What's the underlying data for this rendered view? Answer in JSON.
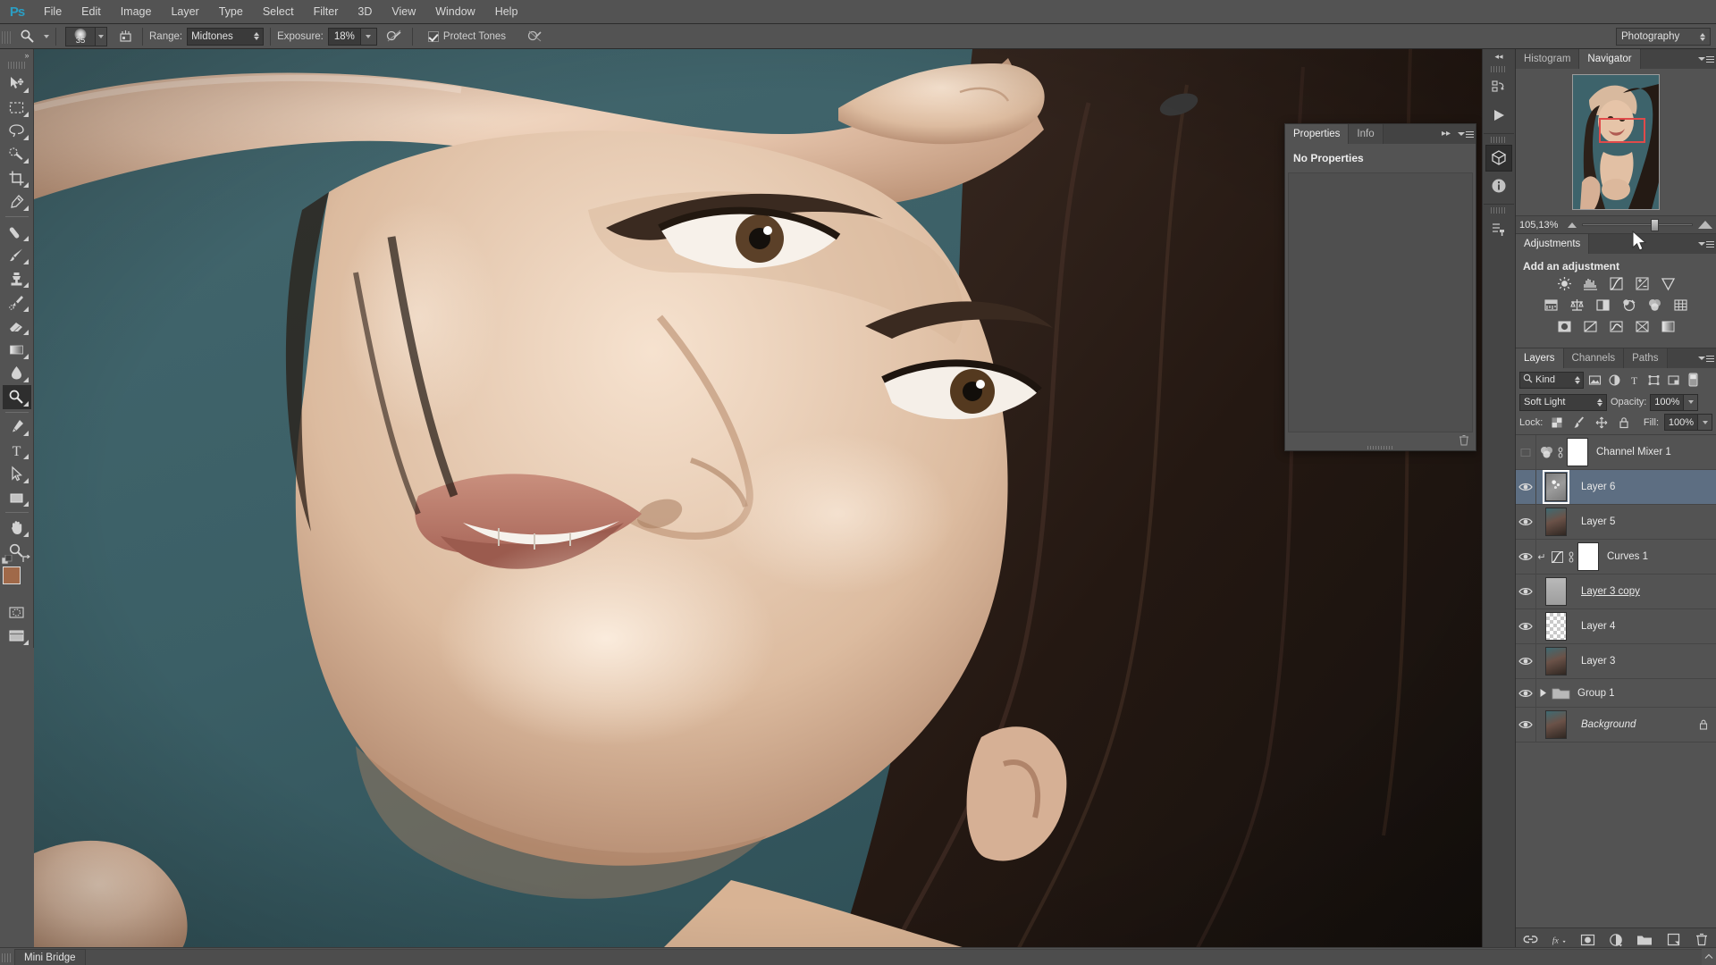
{
  "app": {
    "name": "Adobe Photoshop",
    "logo_text": "Ps"
  },
  "menubar": {
    "items": [
      {
        "label": "File"
      },
      {
        "label": "Edit"
      },
      {
        "label": "Image"
      },
      {
        "label": "Layer"
      },
      {
        "label": "Type"
      },
      {
        "label": "Select"
      },
      {
        "label": "Filter"
      },
      {
        "label": "3D"
      },
      {
        "label": "View"
      },
      {
        "label": "Window"
      },
      {
        "label": "Help"
      }
    ]
  },
  "options_bar": {
    "tool_icon": "dodge-tool-icon",
    "brush_size": "35",
    "range_label": "Range:",
    "range_value": "Midtones",
    "exposure_label": "Exposure:",
    "exposure_value": "18%",
    "airbrush_icon": "airbrush-icon",
    "protect_tones_label": "Protect Tones",
    "protect_tones_checked": true,
    "pressure_icon": "tablet-pressure-icon",
    "workspace": "Photography"
  },
  "toolbar": {
    "collapse_icon": "double-chevron-right-icon",
    "tools": [
      {
        "name": "move-tool",
        "icon": "move-icon",
        "selected": false,
        "has_flyout": true
      },
      {
        "name": "marquee-tool",
        "icon": "rectangular-marquee-icon",
        "selected": false,
        "has_flyout": true
      },
      {
        "name": "lasso-tool",
        "icon": "lasso-icon",
        "selected": false,
        "has_flyout": true
      },
      {
        "name": "quick-selection-tool",
        "icon": "quick-selection-icon",
        "selected": false,
        "has_flyout": true
      },
      {
        "name": "crop-tool",
        "icon": "crop-icon",
        "selected": false,
        "has_flyout": true
      },
      {
        "name": "eyedropper-tool",
        "icon": "eyedropper-icon",
        "selected": false,
        "has_flyout": true
      },
      {
        "name": "healing-brush-tool",
        "icon": "healing-brush-icon",
        "selected": false,
        "has_flyout": true
      },
      {
        "name": "brush-tool",
        "icon": "brush-icon",
        "selected": false,
        "has_flyout": true
      },
      {
        "name": "clone-stamp-tool",
        "icon": "clone-stamp-icon",
        "selected": false,
        "has_flyout": true
      },
      {
        "name": "history-brush-tool",
        "icon": "history-brush-icon",
        "selected": false,
        "has_flyout": true
      },
      {
        "name": "eraser-tool",
        "icon": "eraser-icon",
        "selected": false,
        "has_flyout": true
      },
      {
        "name": "gradient-tool",
        "icon": "gradient-icon",
        "selected": false,
        "has_flyout": true
      },
      {
        "name": "blur-tool",
        "icon": "blur-droplet-icon",
        "selected": false,
        "has_flyout": true
      },
      {
        "name": "dodge-tool",
        "icon": "dodge-icon",
        "selected": true,
        "has_flyout": true
      },
      {
        "name": "pen-tool",
        "icon": "pen-icon",
        "selected": false,
        "has_flyout": true
      },
      {
        "name": "type-tool",
        "icon": "type-t-icon",
        "selected": false,
        "has_flyout": true
      },
      {
        "name": "path-selection-tool",
        "icon": "path-arrow-icon",
        "selected": false,
        "has_flyout": true
      },
      {
        "name": "shape-tool",
        "icon": "rectangle-shape-icon",
        "selected": false,
        "has_flyout": true
      },
      {
        "name": "hand-tool",
        "icon": "hand-icon",
        "selected": false,
        "has_flyout": true
      },
      {
        "name": "zoom-tool",
        "icon": "magnifier-icon",
        "selected": false,
        "has_flyout": false
      }
    ],
    "foreground_color": "#a06949",
    "background_color": "#b78a72",
    "quick_mask_icon": "quick-mask-icon",
    "screen_mode_icon": "screen-mode-icon"
  },
  "dock_rail": {
    "collapse_icon": "double-chevron-left-icon",
    "buttons": [
      {
        "name": "history-panel-icon",
        "active": false
      },
      {
        "name": "actions-play-icon",
        "active": false
      },
      {
        "name": "mini-bridge-icon",
        "active": true
      },
      {
        "name": "info-panel-icon",
        "active": false
      },
      {
        "name": "tool-presets-icon",
        "active": false
      }
    ]
  },
  "navigator_panel": {
    "tabs": [
      {
        "label": "Histogram",
        "active": false
      },
      {
        "label": "Navigator",
        "active": true
      }
    ],
    "zoom_level": "105,13%",
    "viewbox_color": "#e04a4a"
  },
  "adjustments_panel": {
    "tab_label": "Adjustments",
    "heading": "Add an adjustment",
    "rows": [
      [
        {
          "name": "brightness-contrast-icon"
        },
        {
          "name": "levels-icon"
        },
        {
          "name": "curves-icon"
        },
        {
          "name": "exposure-icon"
        },
        {
          "name": "vibrance-icon"
        }
      ],
      [
        {
          "name": "hue-saturation-icon"
        },
        {
          "name": "color-balance-icon"
        },
        {
          "name": "black-white-icon"
        },
        {
          "name": "photo-filter-icon"
        },
        {
          "name": "channel-mixer-icon"
        },
        {
          "name": "color-lookup-icon"
        }
      ],
      [
        {
          "name": "invert-icon"
        },
        {
          "name": "posterize-icon"
        },
        {
          "name": "threshold-icon"
        },
        {
          "name": "selective-color-icon"
        },
        {
          "name": "gradient-map-icon"
        }
      ]
    ]
  },
  "layers_panel": {
    "tabs": [
      {
        "label": "Layers",
        "active": true
      },
      {
        "label": "Channels",
        "active": false
      },
      {
        "label": "Paths",
        "active": false
      }
    ],
    "filter": {
      "search_icon": "search-icon",
      "kind_label": "Kind",
      "buttons": [
        {
          "name": "filter-pixel-icon"
        },
        {
          "name": "filter-adjustment-icon"
        },
        {
          "name": "filter-type-icon"
        },
        {
          "name": "filter-shape-icon"
        },
        {
          "name": "filter-smart-object-icon"
        }
      ],
      "toggle_icon": "filter-toggle-icon"
    },
    "blend_mode": "Soft Light",
    "opacity_label": "Opacity:",
    "opacity_value": "100%",
    "lock_label": "Lock:",
    "lock_buttons": [
      {
        "name": "lock-transparency-icon"
      },
      {
        "name": "lock-image-icon"
      },
      {
        "name": "lock-position-icon"
      },
      {
        "name": "lock-all-icon"
      }
    ],
    "fill_label": "Fill:",
    "fill_value": "100%",
    "layers": [
      {
        "name": "Channel Mixer 1",
        "type": "adjustment",
        "visible": false,
        "selected": false,
        "thumb": "adjustment",
        "badge": "channel-mixer-icon",
        "has_mask": true,
        "linked": true,
        "locked": false,
        "clipped": false,
        "italic": false,
        "underline": false
      },
      {
        "name": "Layer 6",
        "type": "pixel",
        "visible": true,
        "selected": true,
        "thumb": "dodge",
        "badge": null,
        "has_mask": false,
        "linked": false,
        "locked": false,
        "clipped": false,
        "italic": false,
        "underline": false
      },
      {
        "name": "Layer 5",
        "type": "pixel",
        "visible": true,
        "selected": false,
        "thumb": "photo",
        "badge": null,
        "has_mask": false,
        "linked": false,
        "locked": false,
        "clipped": false,
        "italic": false,
        "underline": false
      },
      {
        "name": "Curves 1",
        "type": "adjustment",
        "visible": true,
        "selected": false,
        "thumb": "adjustment",
        "badge": "curves-icon",
        "has_mask": true,
        "linked": true,
        "locked": false,
        "clipped": true,
        "italic": false,
        "underline": false
      },
      {
        "name": "Layer 3 copy",
        "type": "pixel",
        "visible": true,
        "selected": false,
        "thumb": "gray",
        "badge": null,
        "has_mask": false,
        "linked": false,
        "locked": false,
        "clipped": false,
        "italic": false,
        "underline": true
      },
      {
        "name": "Layer 4",
        "type": "pixel",
        "visible": true,
        "selected": false,
        "thumb": "checker",
        "badge": null,
        "has_mask": false,
        "linked": false,
        "locked": false,
        "clipped": false,
        "italic": false,
        "underline": false
      },
      {
        "name": "Layer 3",
        "type": "pixel",
        "visible": true,
        "selected": false,
        "thumb": "photo",
        "badge": null,
        "has_mask": false,
        "linked": false,
        "locked": false,
        "clipped": false,
        "italic": false,
        "underline": false
      },
      {
        "name": "Group 1",
        "type": "group",
        "visible": true,
        "selected": false,
        "thumb": "folder",
        "badge": null,
        "has_mask": false,
        "linked": false,
        "locked": false,
        "clipped": false,
        "italic": false,
        "underline": false
      },
      {
        "name": "Background",
        "type": "background",
        "visible": true,
        "selected": false,
        "thumb": "photo",
        "badge": null,
        "has_mask": false,
        "linked": false,
        "locked": true,
        "clipped": false,
        "italic": true,
        "underline": false
      }
    ],
    "footer_buttons": [
      {
        "name": "link-layers-icon"
      },
      {
        "name": "layer-style-fx-icon"
      },
      {
        "name": "add-layer-mask-icon"
      },
      {
        "name": "new-adjustment-layer-icon"
      },
      {
        "name": "new-group-icon"
      },
      {
        "name": "new-layer-icon"
      },
      {
        "name": "delete-layer-icon"
      }
    ]
  },
  "properties_panel": {
    "tabs": [
      {
        "label": "Properties",
        "active": true
      },
      {
        "label": "Info",
        "active": false
      }
    ],
    "body_text": "No Properties",
    "collapse_icon": "double-chevron-right-icon"
  },
  "statusbar": {
    "mini_bridge_label": "Mini Bridge"
  },
  "canvas": {
    "background_color": "#3e6168",
    "subject": "portrait-photo"
  }
}
